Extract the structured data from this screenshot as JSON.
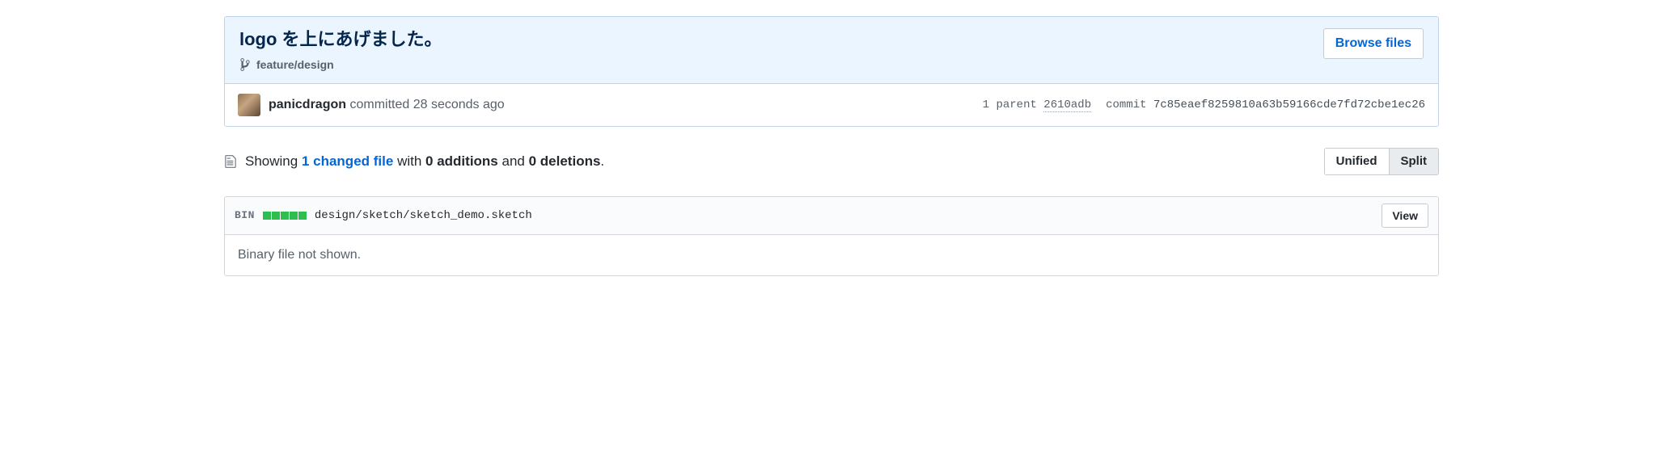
{
  "commit": {
    "title": "logo を上にあげました。",
    "branch": "feature/design",
    "browse_files_label": "Browse files",
    "author": "panicdragon",
    "action_text": "committed",
    "relative_time": "28 seconds ago",
    "parent_label_prefix": "1 parent",
    "parent_sha_short": "2610adb",
    "commit_label": "commit",
    "full_sha": "7c85eaef8259810a63b59166cde7fd72cbe1ec26"
  },
  "diffstat": {
    "showing_prefix": "Showing",
    "changed_files_link": "1 changed file",
    "with_text": "with",
    "additions_text": "0 additions",
    "and_text": "and",
    "deletions_text": "0 deletions",
    "period": "."
  },
  "view_toggle": {
    "unified_label": "Unified",
    "split_label": "Split",
    "selected": "split"
  },
  "file": {
    "bin_tag": "BIN",
    "path": "design/sketch/sketch_demo.sketch",
    "view_label": "View",
    "body_message": "Binary file not shown."
  }
}
